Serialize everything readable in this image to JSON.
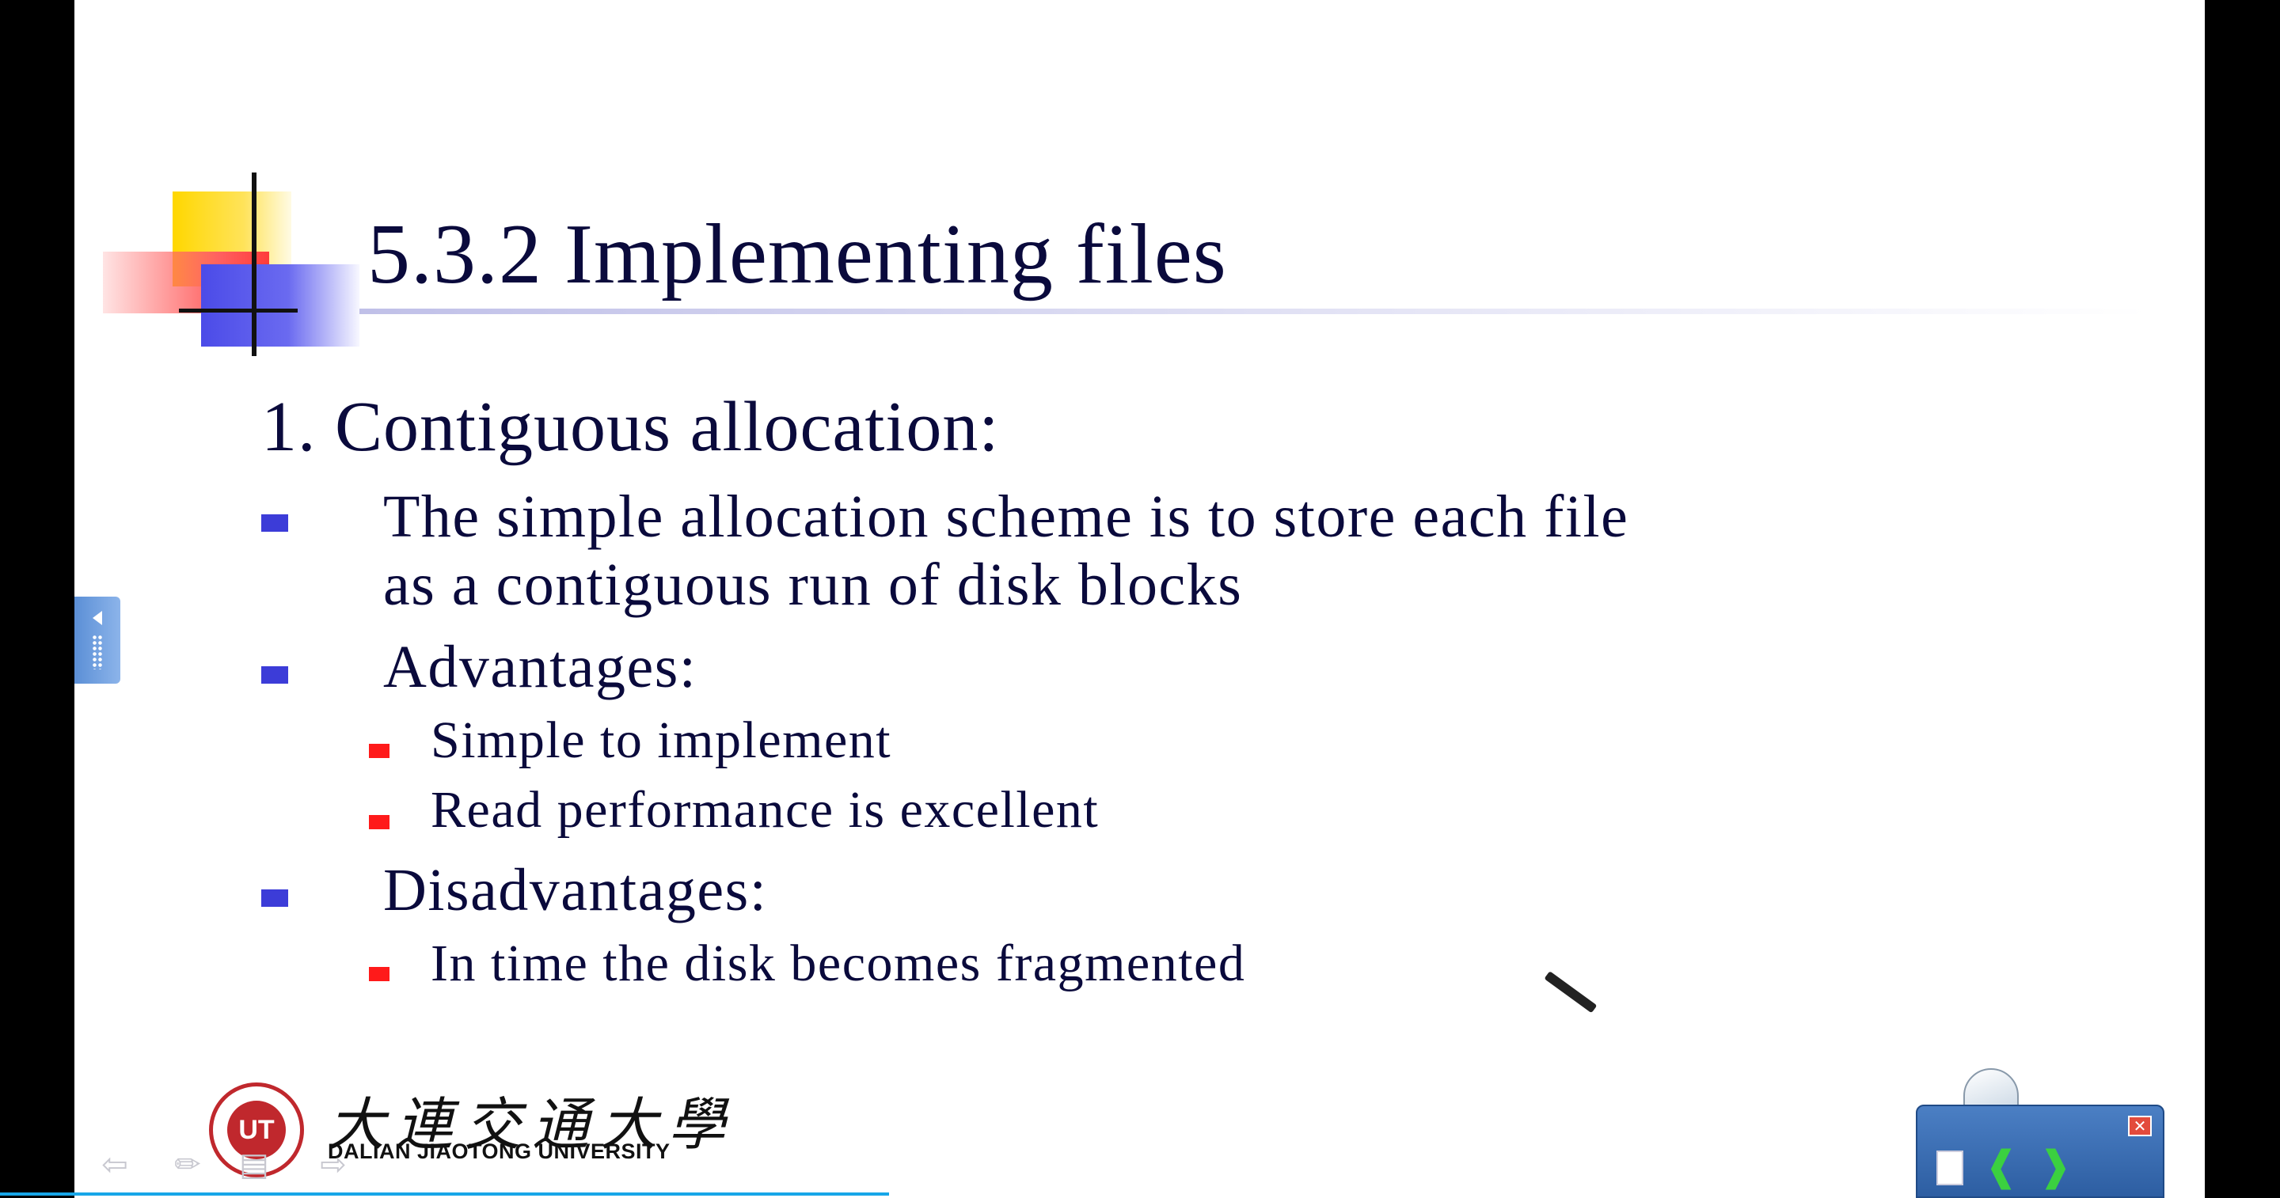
{
  "slide": {
    "title": "5.3.2 Implementing files",
    "heading": "1. Contiguous allocation:",
    "bullets": [
      {
        "line1": "The simple allocation scheme is to store each file",
        "line2": "as a contiguous run of disk blocks"
      },
      {
        "label": "Advantages:",
        "sub": [
          "Simple to implement",
          "Read performance is excellent"
        ]
      },
      {
        "label": "Disadvantages:",
        "sub": [
          "In time the disk becomes fragmented"
        ]
      }
    ]
  },
  "logo": {
    "seal_text": "UT",
    "chinese_name": "大連交通大學",
    "english_name": "DALIAN JIAOTONG UNIVERSITY"
  },
  "nav": {
    "prev_icon": "arrow-left-icon",
    "pen_icon": "pen-icon",
    "menu_icon": "menu-icon",
    "next_icon": "arrow-right-icon"
  },
  "widget": {
    "close_icon": "close-icon",
    "doc_icon": "document-icon",
    "prev_icon": "green-left-arrow-icon",
    "next_icon": "green-right-arrow-icon"
  },
  "colors": {
    "title_text": "#0a0a3c",
    "bullet_blue": "#3c3cd8",
    "bullet_red": "#ff1a1a",
    "progress": "#17a6e8"
  },
  "progress": 0.39
}
